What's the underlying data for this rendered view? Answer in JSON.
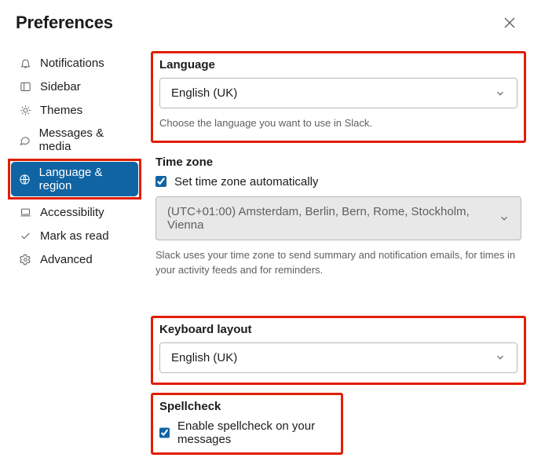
{
  "header": {
    "title": "Preferences"
  },
  "sidebar": {
    "items": [
      {
        "label": "Notifications"
      },
      {
        "label": "Sidebar"
      },
      {
        "label": "Themes"
      },
      {
        "label": "Messages & media"
      },
      {
        "label": "Language & region"
      },
      {
        "label": "Accessibility"
      },
      {
        "label": "Mark as read"
      },
      {
        "label": "Advanced"
      }
    ]
  },
  "language": {
    "label": "Language",
    "value": "English (UK)",
    "helper": "Choose the language you want to use in Slack."
  },
  "timezone": {
    "label": "Time zone",
    "auto_label": "Set time zone automatically",
    "auto_checked": true,
    "value": "(UTC+01:00) Amsterdam, Berlin, Bern, Rome, Stockholm, Vienna",
    "helper": "Slack uses your time zone to send summary and notification emails, for times in your activity feeds and for reminders."
  },
  "keyboard": {
    "label": "Keyboard layout",
    "value": "English (UK)"
  },
  "spellcheck": {
    "label": "Spellcheck",
    "checkbox_label": "Enable spellcheck on your messages",
    "checked": true
  }
}
